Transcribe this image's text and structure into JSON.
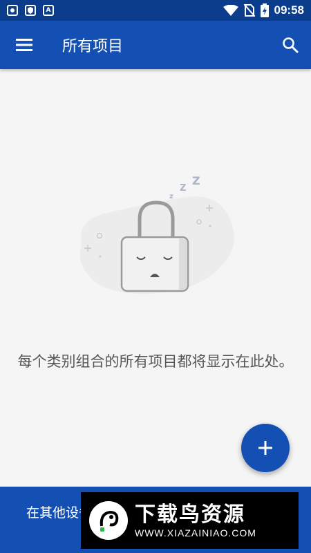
{
  "status_bar": {
    "time": "09:58",
    "left_icons": [
      "app-notification-icon",
      "shield-icon",
      "a-letter-icon"
    ],
    "right_icons": [
      "wifi-icon",
      "no-sim-icon",
      "battery-charging-icon"
    ],
    "a_icon_letter": "A"
  },
  "app_bar": {
    "title": "所有项目",
    "menu_icon": "hamburger-menu-icon",
    "search_icon": "search-icon"
  },
  "empty_state": {
    "illustration": "sleeping-lock",
    "sleep_letters": [
      "z",
      "Z",
      "Z"
    ],
    "message": "每个类别组合的所有项目都将显示在此处。"
  },
  "fab": {
    "icon": "plus-icon"
  },
  "bottom_banner": {
    "text": "在其他设备上登录 版。"
  },
  "watermark": {
    "title": "下载鸟资源",
    "url": "WWW.XIAZAINIAO.COM"
  },
  "colors": {
    "status_bar": "#0b3d8c",
    "primary": "#1450b4",
    "background": "#f5f5f5"
  }
}
